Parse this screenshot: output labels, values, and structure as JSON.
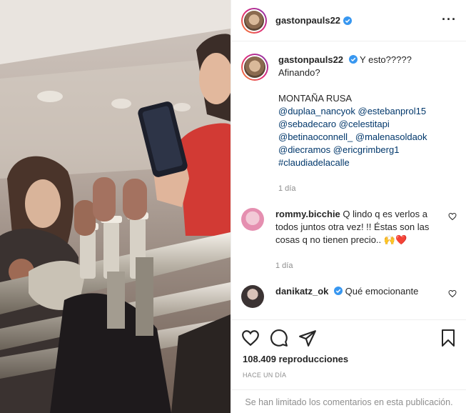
{
  "post": {
    "author": "gastonpauls22",
    "caption": {
      "first_line": "Y esto?????",
      "second_line": "Afinando?",
      "third_line": "MONTAÑA RUSA",
      "tag_lines": [
        "@duplaa_nancyok @estebanprol15",
        "@sebadecaro @celestitapi",
        "@betinaoconnell_ @malenasoldaok",
        "@diecramos @ericgrimberg1",
        "#claudiadelacalle"
      ],
      "time": "1 día"
    },
    "comments": [
      {
        "user": "rommy.bicchie",
        "text": "Q lindo q es verlos a todos juntos otra vez! !! Éstas son las cosas q no tienen precio.. 🙌❤️",
        "time": "1 día"
      },
      {
        "user": "danikatz_ok",
        "text": "Qué emocionante",
        "time": ""
      }
    ],
    "views": "108.409 reproducciones",
    "posted": "HACE UN DÍA",
    "limited_notice": "Se han limitado los comentarios en esta publicación."
  },
  "icons": {
    "more": "more-options-icon",
    "verified": "verified-badge-icon",
    "like": "heart-icon",
    "comment": "comment-icon",
    "share": "paper-plane-icon",
    "save": "bookmark-icon"
  },
  "colors": {
    "verified": "#3897f0",
    "link": "#00376b",
    "muted": "#8e8e8e",
    "border": "#efefef"
  }
}
